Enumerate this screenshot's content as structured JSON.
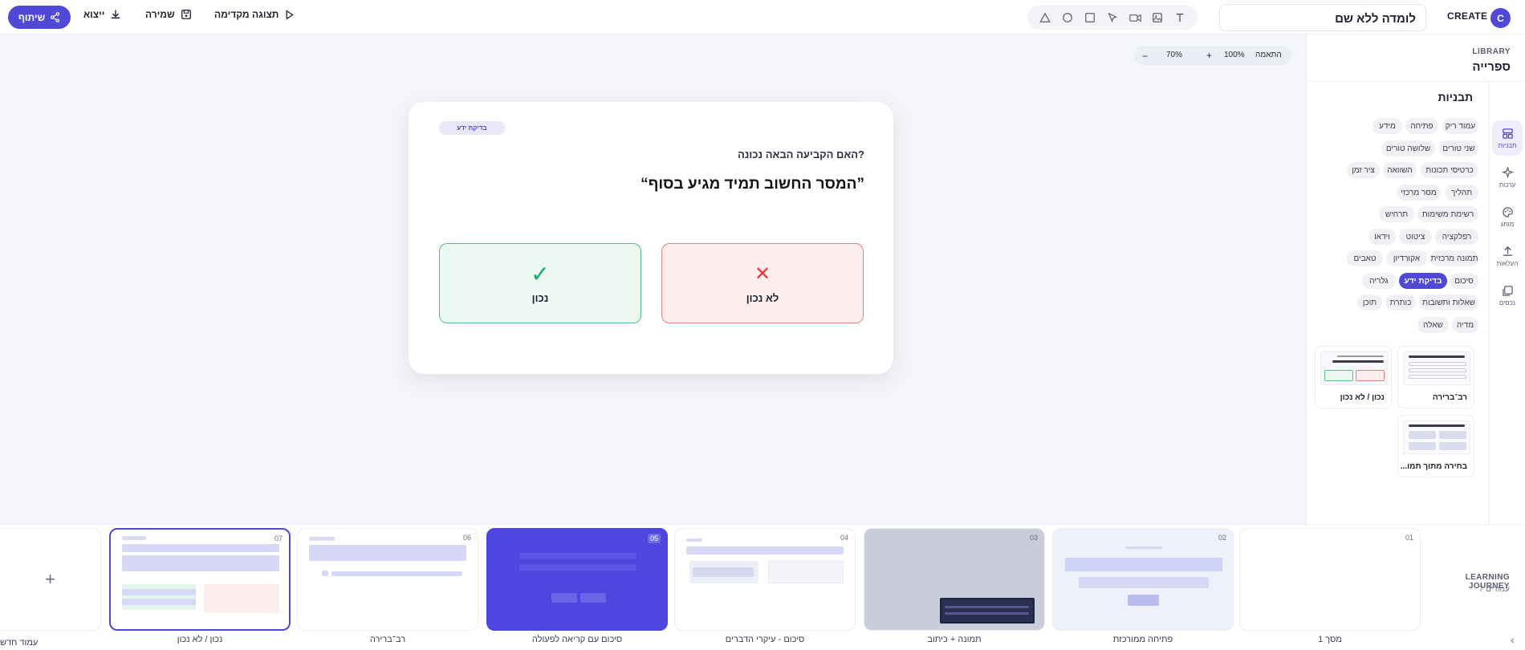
{
  "header": {
    "share_label": "שיתוף",
    "export_label": "ייצוא",
    "save_label": "שמירה",
    "preview_label": "תצוגה מקדימה",
    "title_value": "לומדה ללא שם",
    "brand": "CREATE",
    "avatar_initial": "C",
    "tools": [
      "triangle-icon",
      "circle-icon",
      "square-icon",
      "cursor-icon",
      "video-icon",
      "image-icon",
      "text-icon"
    ]
  },
  "zoom": {
    "minus": "−",
    "level": "70%",
    "plus": "+",
    "full": "100%",
    "fit": "התאמה"
  },
  "card": {
    "badge": "בדיקת ידע",
    "question": "?האם הקביעה הבאה נכונה",
    "statement": "”המסר החשוב תמיד מגיע בסוף“",
    "true_mark": "✓",
    "true_label": "נכון",
    "false_mark": "✕",
    "false_label": "לא נכון",
    "colors": {
      "accent": "#5048d6",
      "true": "#1aa56b",
      "false": "#e53935"
    }
  },
  "sidebar": {
    "library_en": "LIBRARY",
    "library_he": "ספרייה",
    "panel_title": "תבניות",
    "rail": [
      {
        "icon": "layout-icon",
        "label": "תבניות",
        "active": true
      },
      {
        "icon": "sparkle-icon",
        "label": "ערכות",
        "active": false
      },
      {
        "icon": "palette-icon",
        "label": "מותג",
        "active": false
      },
      {
        "icon": "upload-icon",
        "label": "העלאות",
        "active": false
      },
      {
        "icon": "assets-icon",
        "label": "נכסים",
        "active": false
      }
    ],
    "chips": [
      "עמוד ריק",
      "פתיחה",
      "מידע",
      "שני טורים",
      "שלושה טורים",
      "כרטיסי תכונות",
      "השוואה",
      "ציר זמן",
      "תהליך",
      "מסר מרכזי",
      "רשימת משימות",
      "תרחיש",
      "רפלקציה",
      "ציטוט",
      "וידאו",
      "תמונה מרכזית",
      "אקורדיון",
      "טאבים",
      "סיכום",
      "בדיקת ידע",
      "גלריה",
      "שאלות ותשובות",
      "כותרת",
      "תוכן",
      "מדיה",
      "שאלה"
    ],
    "active_chip": "בדיקת ידע",
    "templates": [
      {
        "label": "רב־ברירה"
      },
      {
        "label": "נכון / לא נכון"
      },
      {
        "label": "בחירה מתוך תמו..."
      }
    ]
  },
  "journey": {
    "title_en": "LEARNING JOURNEY",
    "count_he": "7 עמודים",
    "slides": [
      {
        "num": "01",
        "label": "מסך 1"
      },
      {
        "num": "02",
        "label": "פתיחה ממורכזת"
      },
      {
        "num": "03",
        "label": "תמונה + כיתוב"
      },
      {
        "num": "04",
        "label": "סיכום - עיקרי הדברים"
      },
      {
        "num": "05",
        "label": "סיכום עם קריאה לפעולה"
      },
      {
        "num": "06",
        "label": "רב־ברירה"
      },
      {
        "num": "07",
        "label": "נכון / לא נכון"
      }
    ],
    "add_label": "עמוד חדש"
  }
}
